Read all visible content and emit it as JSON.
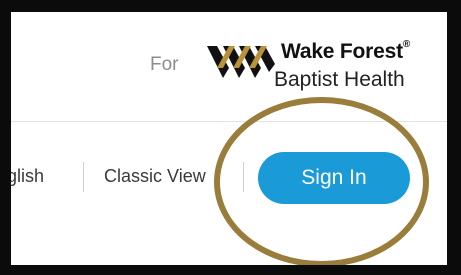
{
  "header": {
    "for_label": "For",
    "brand_line1": "Wake Forest",
    "brand_mark": "®",
    "brand_line2": "Baptist Health",
    "logo_icon": "wake-forest-logo-icon"
  },
  "nav": {
    "language_link": "glish",
    "classic_view_link": "Classic View",
    "sign_in_label": "Sign In"
  },
  "colors": {
    "sign_in_bg": "#1a9ad6",
    "annotation_ring": "#9a7d3b",
    "frame_border": "#0b0b0b"
  }
}
